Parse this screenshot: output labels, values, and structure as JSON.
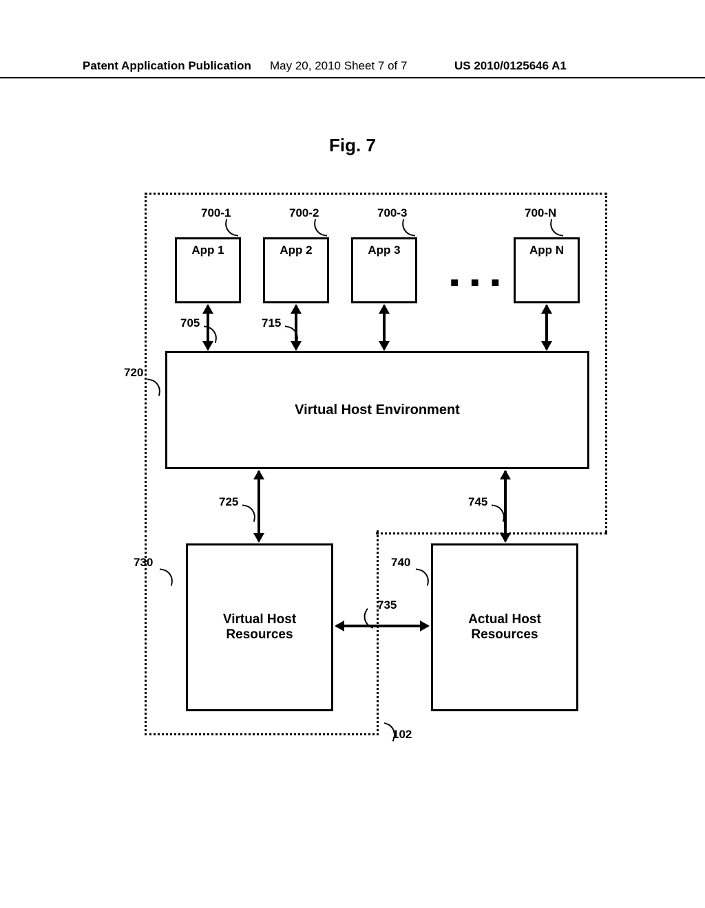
{
  "header": {
    "left": "Patent Application Publication",
    "middle": "May 20, 2010  Sheet 7 of 7",
    "right": "US 2010/0125646 A1"
  },
  "figure_title": "Fig. 7",
  "apps": {
    "app1": "App 1",
    "app2": "App 2",
    "app3": "App 3",
    "appN": "App N",
    "ellipsis": "■ ■ ■"
  },
  "boxes": {
    "vhe": "Virtual Host Environment",
    "vhr": "Virtual Host\nResources",
    "ahr": "Actual Host\nResources"
  },
  "refs": {
    "r700_1": "700-1",
    "r700_2": "700-2",
    "r700_3": "700-3",
    "r700_N": "700-N",
    "r705": "705",
    "r715": "715",
    "r720": "720",
    "r725": "725",
    "r730": "730",
    "r735": "735",
    "r740": "740",
    "r745": "745",
    "r102": "102"
  },
  "chart_data": {
    "type": "diagram",
    "title": "Fig. 7",
    "nodes": [
      {
        "id": "700-1",
        "label": "App 1"
      },
      {
        "id": "700-2",
        "label": "App 2"
      },
      {
        "id": "700-3",
        "label": "App 3"
      },
      {
        "id": "700-N",
        "label": "App N"
      },
      {
        "id": "720",
        "label": "Virtual Host Environment"
      },
      {
        "id": "730",
        "label": "Virtual Host Resources"
      },
      {
        "id": "740",
        "label": "Actual Host Resources"
      }
    ],
    "edges": [
      {
        "from": "700-1",
        "to": "720",
        "ref": "705",
        "bidirectional": true
      },
      {
        "from": "700-2",
        "to": "720",
        "ref": "715",
        "bidirectional": true
      },
      {
        "from": "700-3",
        "to": "720",
        "bidirectional": true
      },
      {
        "from": "700-N",
        "to": "720",
        "bidirectional": true
      },
      {
        "from": "720",
        "to": "730",
        "ref": "725",
        "bidirectional": true
      },
      {
        "from": "720",
        "to": "740",
        "ref": "745",
        "bidirectional": true
      },
      {
        "from": "730",
        "to": "740",
        "ref": "735",
        "bidirectional": true
      }
    ],
    "containers": [
      {
        "ref": "102",
        "contains": [
          "700-1",
          "700-2",
          "700-3",
          "700-N",
          "720",
          "730"
        ],
        "style": "dotted"
      }
    ]
  }
}
